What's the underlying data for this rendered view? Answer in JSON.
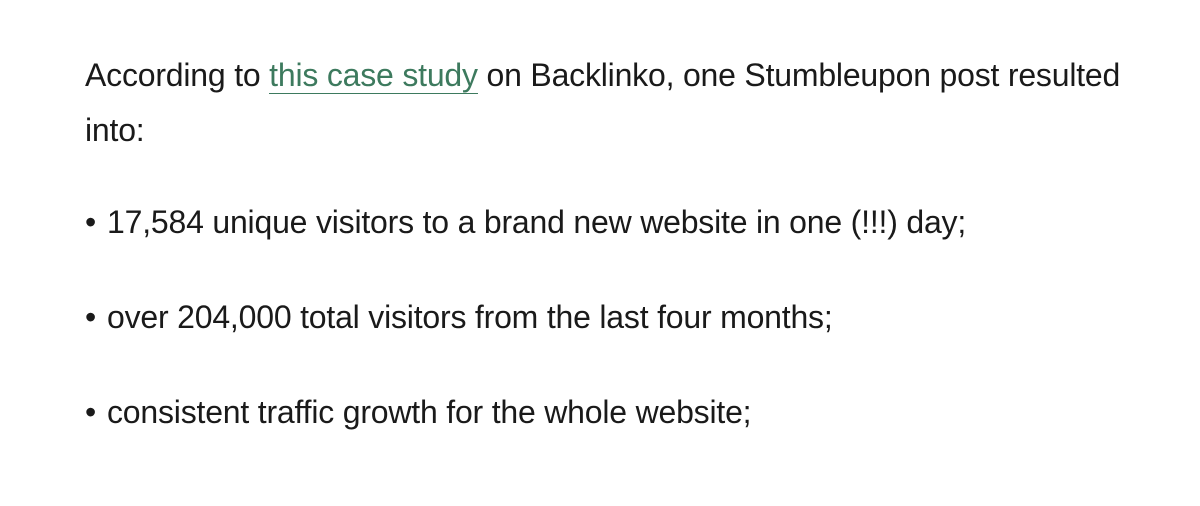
{
  "intro": {
    "before_link": "According to ",
    "link_text": "this case study",
    "after_link": " on Backlinko, one Stumbleupon post resulted into:"
  },
  "bullets": [
    {
      "marker": "•",
      "text": "17,584 unique visitors to a brand new website in one (!!!) day;"
    },
    {
      "marker": "•",
      "text": "over 204,000 total visitors from the last four months;"
    },
    {
      "marker": "•",
      "text": "consistent traffic growth for the whole website;"
    }
  ],
  "colors": {
    "text": "#1a1a1a",
    "link": "#3d7a5e",
    "background": "#ffffff"
  }
}
